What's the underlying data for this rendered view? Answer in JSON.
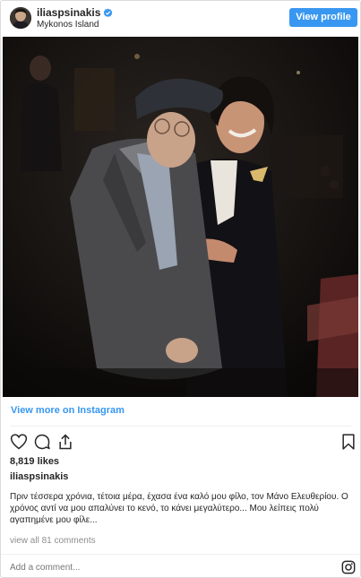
{
  "header": {
    "username": "iliaspsinakis",
    "location": "Mykonos Island",
    "view_profile_label": "View profile",
    "verified": true
  },
  "post": {
    "photo_alt": "photo",
    "view_more_label": "View more on Instagram",
    "likes": "8,819 likes",
    "caption_username": "iliaspsinakis",
    "caption_text": "Πριν τέσσερα χρόνια, τέτοια μέρα, έχασα ένα καλό μου φίλο, τον Μάνο Ελευθερίου. Ο χρόνος αντί να μου απαλύνει το κενό, το κάνει μεγαλύτερο... Μου λείπεις πολύ αγαπημένε μου φίλε...",
    "comments_label": "view all 81 comments",
    "add_comment_placeholder": "Add a comment..."
  },
  "icons": {
    "like": "heart-icon",
    "comment": "comment-icon",
    "share": "share-icon",
    "save": "bookmark-icon",
    "instagram": "instagram-icon",
    "verified": "verified-badge-icon"
  },
  "colors": {
    "accent": "#3897f0",
    "text": "#262626",
    "muted": "#8e8e8e",
    "border": "#dbdbdb"
  }
}
